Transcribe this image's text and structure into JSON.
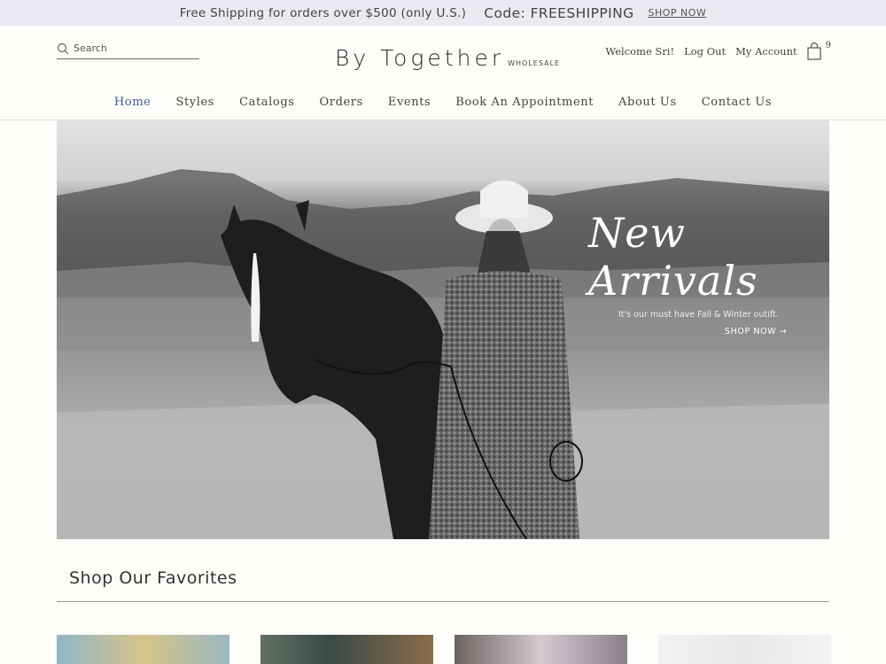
{
  "promo": {
    "text": "Free Shipping for orders over $500 (only U.S.)",
    "code": "Code: FREESHIPPING",
    "link": "SHOP NOW"
  },
  "search": {
    "placeholder": "Search"
  },
  "logo": {
    "main": "By Together",
    "sub": "WHOLESALE"
  },
  "account": {
    "welcome": "Welcome Sri!",
    "logout": "Log Out",
    "my_account": "My Account",
    "cart_count": "9"
  },
  "nav": {
    "items": [
      "Home",
      "Styles",
      "Catalogs",
      "Orders",
      "Events",
      "Book An Appointment",
      "About Us",
      "Contact Us"
    ],
    "active": "Home"
  },
  "hero": {
    "title": "New Arrivals",
    "subtitle": "It's our must have Fall & Winter outift.",
    "cta": "SHOP NOW →"
  },
  "favorites": {
    "title": "Shop Our Favorites"
  },
  "colors": {
    "promo_bg": "#e9eaf2",
    "nav_active": "#3e5b9a",
    "page_bg": "#fdfdf9"
  }
}
